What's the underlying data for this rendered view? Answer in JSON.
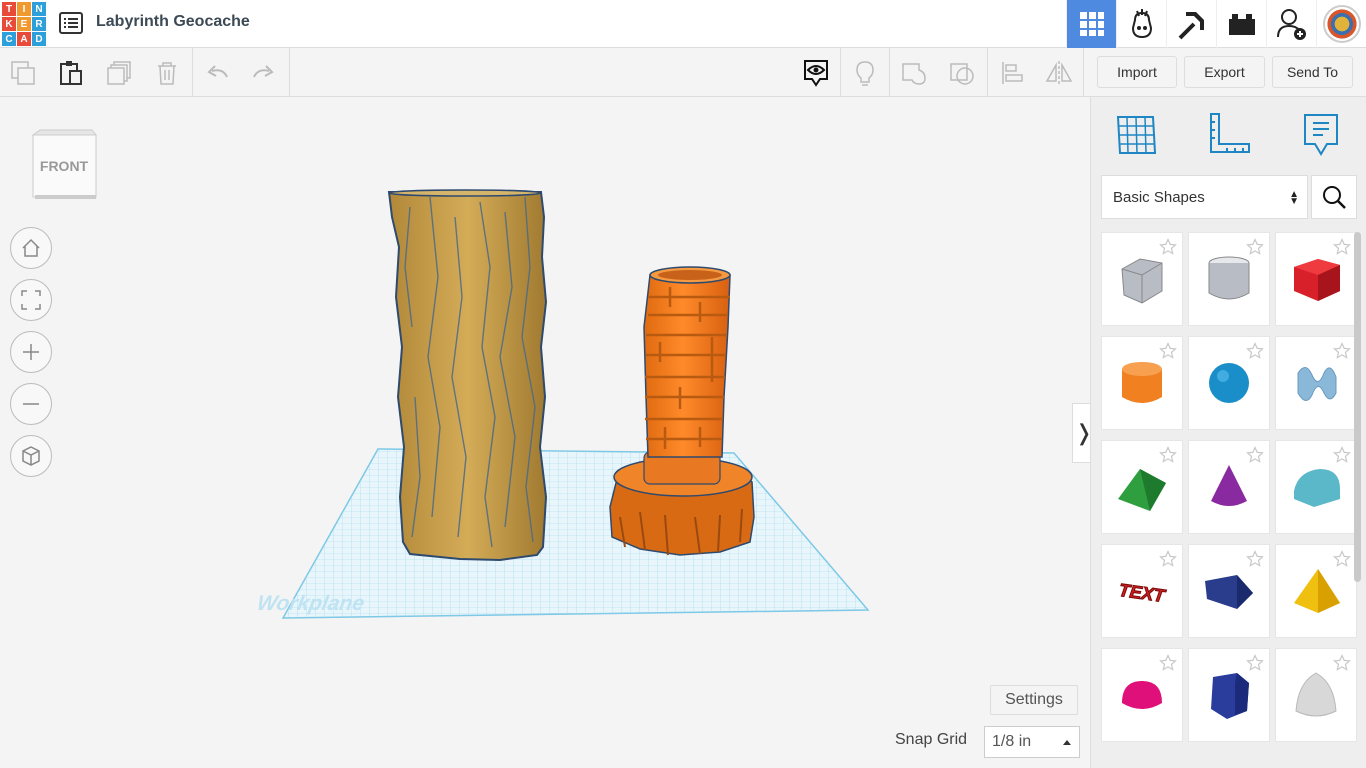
{
  "header": {
    "logo_letters": [
      "T",
      "I",
      "N",
      "K",
      "E",
      "R",
      "C",
      "A",
      "D"
    ],
    "logo_colors": [
      "#e84b3a",
      "#f0992f",
      "#2d9fdb",
      "#e84b3a",
      "#f0992f",
      "#2d9fdb",
      "#2d9fdb",
      "#e84b3a",
      "#2d9fdb"
    ],
    "title": "Labyrinth Geocache",
    "nav_icons": [
      "3d-design-grid-icon",
      "codeblocks-icon",
      "minecraft-pickaxe-icon",
      "lego-brick-icon",
      "add-user-icon",
      "user-avatar-icon"
    ],
    "active_color": "#4e8be0"
  },
  "toolbar": {
    "import_label": "Import",
    "export_label": "Export",
    "send_to_label": "Send To",
    "tools": [
      "copy-icon",
      "paste-icon",
      "duplicate-icon",
      "delete-icon",
      "undo-icon",
      "redo-icon",
      "notes-eye-icon",
      "light-bulb-icon",
      "group-icon",
      "ungroup-icon",
      "align-icon",
      "mirror-icon"
    ]
  },
  "workspace": {
    "viewcube_label": "FRONT",
    "workplane_label": "Workplane",
    "settings_label": "Settings",
    "snap_grid_label": "Snap Grid",
    "snap_grid_value": "1/8 in",
    "collapse_glyph": "❭",
    "objects": [
      {
        "name": "tree-trunk-cylinder",
        "color": "#c8a04a"
      },
      {
        "name": "labyrinth-tower",
        "color": "#f08020"
      }
    ]
  },
  "panel": {
    "category": "Basic Shapes",
    "shapes": [
      "Box (Hole)",
      "Cylinder (Hole)",
      "Box",
      "Cylinder",
      "Sphere",
      "Scribble",
      "Roof",
      "Cone",
      "Round Roof",
      "Text",
      "Half Sphere-ish Prism",
      "Pyramid",
      "Half Sphere",
      "Polygon",
      "Paraboloid"
    ],
    "shape_colors": {
      "hole": "#b8bcc4",
      "box": "#d8202a",
      "cylinder": "#f08020",
      "sphere": "#1a8ec8",
      "scribble": "#8ab8d8",
      "roof": "#2e9e3e",
      "cone": "#8a2aa0",
      "round_roof": "#5ab8c8",
      "text": "#d02020",
      "wedge": "#2a3c8c",
      "pyramid": "#f0c010",
      "half_sphere": "#e0107a",
      "polygon": "#2a3c9c",
      "paraboloid": "#d8d8d8"
    }
  }
}
